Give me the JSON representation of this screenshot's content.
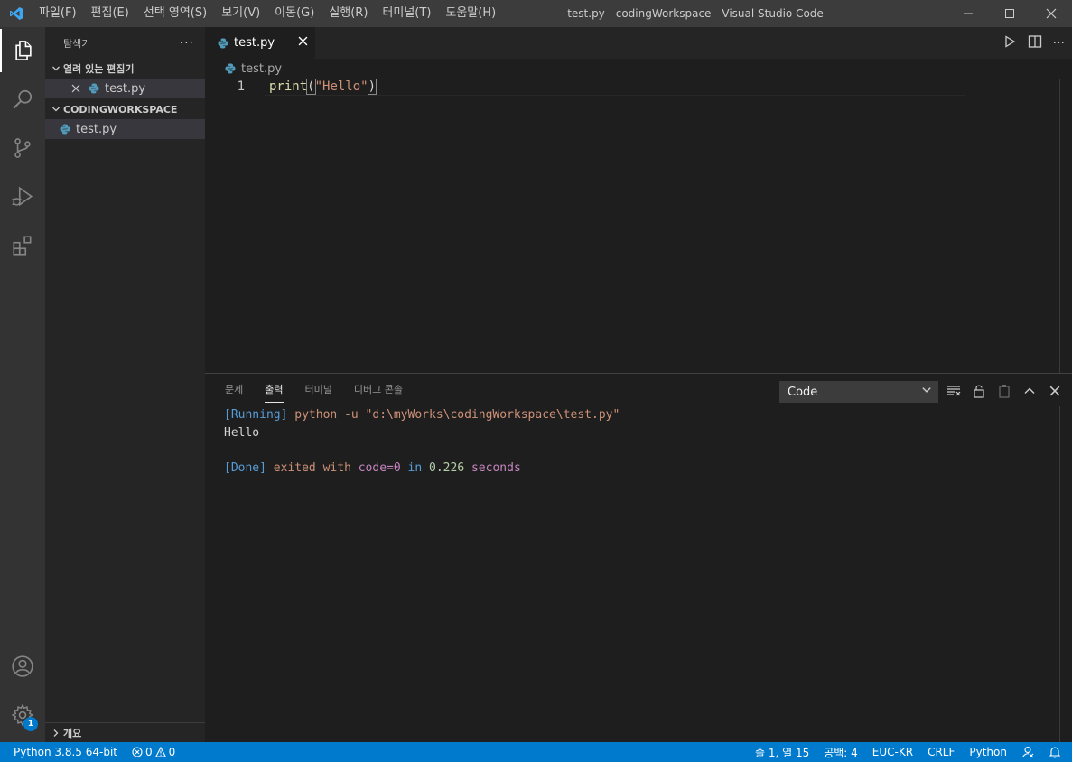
{
  "titlebar": {
    "menu": [
      "파일(F)",
      "편집(E)",
      "선택 영역(S)",
      "보기(V)",
      "이동(G)",
      "실행(R)",
      "터미널(T)",
      "도움말(H)"
    ],
    "window_title": "test.py - codingWorkspace - Visual Studio Code"
  },
  "activitybar": {
    "items": [
      "explorer-icon",
      "search-icon",
      "source-control-icon",
      "run-debug-icon",
      "extensions-icon"
    ],
    "bottom": [
      "accounts-icon",
      "manage-gear-icon"
    ],
    "settings_badge": "1"
  },
  "sidebar": {
    "title": "탐색기",
    "open_editors_label": "열려 있는 편집기",
    "open_editors": [
      {
        "name": "test.py"
      }
    ],
    "workspace_label": "CODINGWORKSPACE",
    "files": [
      {
        "name": "test.py"
      }
    ],
    "outline_label": "개요"
  },
  "editor": {
    "tab_label": "test.py",
    "breadcrumb": "test.py",
    "lines": [
      {
        "number": "1",
        "fn": "print",
        "open": "(",
        "string": "\"Hello\"",
        "close": ")"
      }
    ]
  },
  "panel": {
    "tabs": [
      "문제",
      "출력",
      "터미널",
      "디버그 콘솔"
    ],
    "active_tab": "출력",
    "select_value": "Code",
    "output": {
      "running_tag": "[Running]",
      "running_cmd": " python -u \"d:\\myWorks\\codingWorkspace\\test.py\"",
      "result": "Hello",
      "done_tag": "[Done]",
      "exited": " exited ",
      "with": "with ",
      "code_label": "code=0",
      "in": " in ",
      "seconds_value": "0.226",
      "seconds_label": " seconds"
    }
  },
  "statusbar": {
    "interpreter": "Python 3.8.5 64-bit",
    "errors": "0",
    "warnings": "0",
    "position": "줄 1, 열 15",
    "spaces": "공백: 4",
    "encoding": "EUC-KR",
    "eol": "CRLF",
    "language": "Python"
  },
  "colors": {
    "accent": "#007acc",
    "titlebar": "#3c3c3c",
    "activitybar": "#333333",
    "sidebar": "#252526",
    "editor": "#1e1e1e"
  }
}
